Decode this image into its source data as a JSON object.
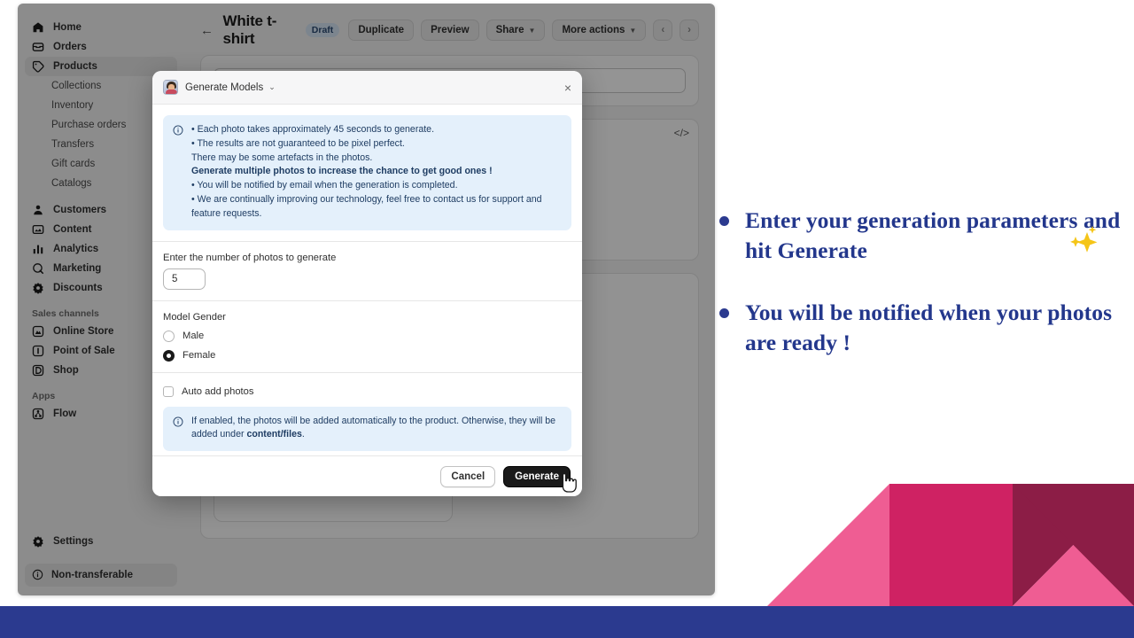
{
  "app": {
    "sidebar": {
      "primary": [
        {
          "label": "Home",
          "icon": "home-icon",
          "active": false
        },
        {
          "label": "Orders",
          "icon": "orders-icon",
          "active": false
        },
        {
          "label": "Products",
          "icon": "products-icon",
          "active": true
        }
      ],
      "product_sub": [
        {
          "label": "Collections"
        },
        {
          "label": "Inventory"
        },
        {
          "label": "Purchase orders"
        },
        {
          "label": "Transfers"
        },
        {
          "label": "Gift cards"
        },
        {
          "label": "Catalogs"
        }
      ],
      "secondary": [
        {
          "label": "Customers",
          "icon": "customers-icon"
        },
        {
          "label": "Content",
          "icon": "content-icon"
        },
        {
          "label": "Analytics",
          "icon": "analytics-icon"
        },
        {
          "label": "Marketing",
          "icon": "marketing-icon"
        },
        {
          "label": "Discounts",
          "icon": "discounts-icon"
        }
      ],
      "sales_channels_heading": "Sales channels",
      "sales_channels": [
        {
          "label": "Online Store",
          "icon": "online-store-icon"
        },
        {
          "label": "Point of Sale",
          "icon": "point-of-sale-icon"
        },
        {
          "label": "Shop",
          "icon": "shop-icon"
        }
      ],
      "apps_heading": "Apps",
      "apps": [
        {
          "label": "Flow",
          "icon": "flow-icon"
        }
      ],
      "settings_label": "Settings",
      "status_badge": "Non-transferable"
    },
    "page": {
      "back_label": "←",
      "title": "White t-shirt",
      "status_chip": "Draft",
      "actions": [
        {
          "label": "Duplicate",
          "caret": false
        },
        {
          "label": "Preview",
          "caret": false
        },
        {
          "label": "Share",
          "caret": true
        },
        {
          "label": "More actions",
          "caret": true
        }
      ],
      "pager_prev": "‹",
      "pager_next": "›",
      "code_icon": "</>"
    }
  },
  "modal": {
    "app_icon": "generate-models-app-icon",
    "title": "Generate Models",
    "title_caret": "⌄",
    "close": "×",
    "info_lines": [
      {
        "text": "• Each photo takes approximately 45 seconds to generate.",
        "bold": false
      },
      {
        "text": "• The results are not guaranteed to be pixel perfect.",
        "bold": false
      },
      {
        "text": "There may be some artefacts in the photos.",
        "bold": false
      },
      {
        "text": "Generate multiple photos to increase the chance to get good ones !",
        "bold": true
      },
      {
        "text": "• You will be notified by email when the generation is completed.",
        "bold": false
      },
      {
        "text": "• We are continually improving our technology, feel free to contact us for support and",
        "bold": false
      },
      {
        "text": "feature requests.",
        "bold": false
      }
    ],
    "count_label": "Enter the number of photos to generate",
    "count_value": "5",
    "gender_label": "Model Gender",
    "gender_options": [
      {
        "label": "Male",
        "selected": false
      },
      {
        "label": "Female",
        "selected": true
      }
    ],
    "auto_add_label": "Auto add photos",
    "auto_add_checked": false,
    "footer_note_pre": "If enabled, the photos will be added automatically to the product. Otherwise, they will be added under ",
    "footer_note_strong": "content/files",
    "footer_note_post": ".",
    "cancel_label": "Cancel",
    "generate_label": "Generate"
  },
  "notes": {
    "items": [
      "Enter your generation parameters and hit Generate",
      "You will be notified when your photos are ready !"
    ],
    "sparkle_icon": "sparkles-icon"
  },
  "colors": {
    "navy": "#23378c",
    "blue_bar": "#2b3a8f",
    "pink_light": "#ef5d93",
    "pink_dark": "#cf2263",
    "maroon": "#8c1d46",
    "info_bg": "#e4f0fb",
    "info_text": "#1f3d63",
    "chip_draft_bg": "#d6e5f5"
  }
}
